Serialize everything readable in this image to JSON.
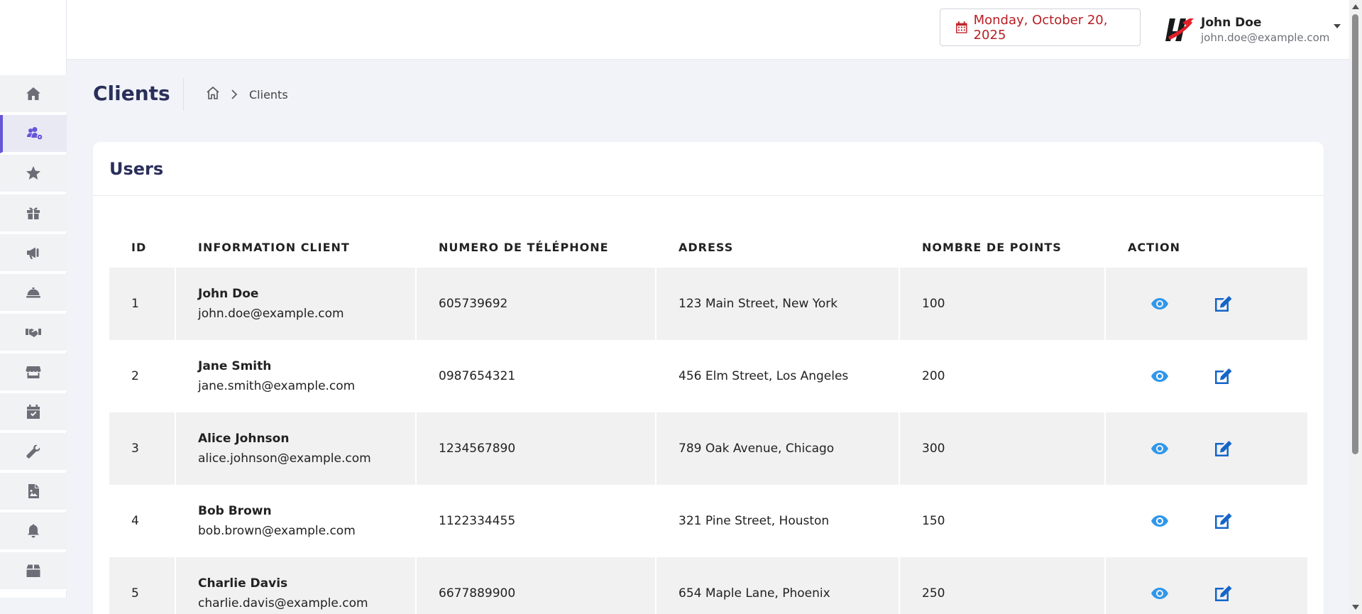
{
  "topbar": {
    "date": "Monday, October 20, 2025",
    "user": {
      "name": "John Doe",
      "email": "john.doe@example.com"
    }
  },
  "sidebar": {
    "items": [
      {
        "icon": "home-icon",
        "active": false
      },
      {
        "icon": "users-cog-icon",
        "active": true
      },
      {
        "icon": "star-icon",
        "active": false
      },
      {
        "icon": "gift-icon",
        "active": false
      },
      {
        "icon": "megaphone-icon",
        "active": false
      },
      {
        "icon": "concierge-bell-icon",
        "active": false
      },
      {
        "icon": "handshake-icon",
        "active": false
      },
      {
        "icon": "store-icon",
        "active": false
      },
      {
        "icon": "calendar-check-icon",
        "active": false
      },
      {
        "icon": "wrench-icon",
        "active": false
      },
      {
        "icon": "file-image-icon",
        "active": false
      },
      {
        "icon": "bell-icon",
        "active": false
      },
      {
        "icon": "box-icon",
        "active": false
      }
    ]
  },
  "header": {
    "title": "Clients",
    "breadcrumb": {
      "current": "Clients"
    }
  },
  "card": {
    "title": "Users",
    "columns": [
      "ID",
      "INFORMATION CLIENT",
      "NUMERO DE TÉLÉPHONE",
      "ADRESS",
      "NOMBRE DE POINTS",
      "ACTION"
    ],
    "rows": [
      {
        "id": "1",
        "name": "John Doe",
        "email": "john.doe@example.com",
        "phone": "605739692",
        "address": "123 Main Street, New York",
        "points": "100"
      },
      {
        "id": "2",
        "name": "Jane Smith",
        "email": "jane.smith@example.com",
        "phone": "0987654321",
        "address": "456 Elm Street, Los Angeles",
        "points": "200"
      },
      {
        "id": "3",
        "name": "Alice Johnson",
        "email": "alice.johnson@example.com",
        "phone": "1234567890",
        "address": "789 Oak Avenue, Chicago",
        "points": "300"
      },
      {
        "id": "4",
        "name": "Bob Brown",
        "email": "bob.brown@example.com",
        "phone": "1122334455",
        "address": "321 Pine Street, Houston",
        "points": "150"
      },
      {
        "id": "5",
        "name": "Charlie Davis",
        "email": "charlie.davis@example.com",
        "phone": "6677889900",
        "address": "654 Maple Lane, Phoenix",
        "points": "250"
      }
    ]
  },
  "colors": {
    "accent": "#6656d8",
    "date_text": "#b81e23",
    "view_icon": "#2f97ea",
    "edit_icon": "#1565c8",
    "title_text": "#2a2f5a"
  }
}
